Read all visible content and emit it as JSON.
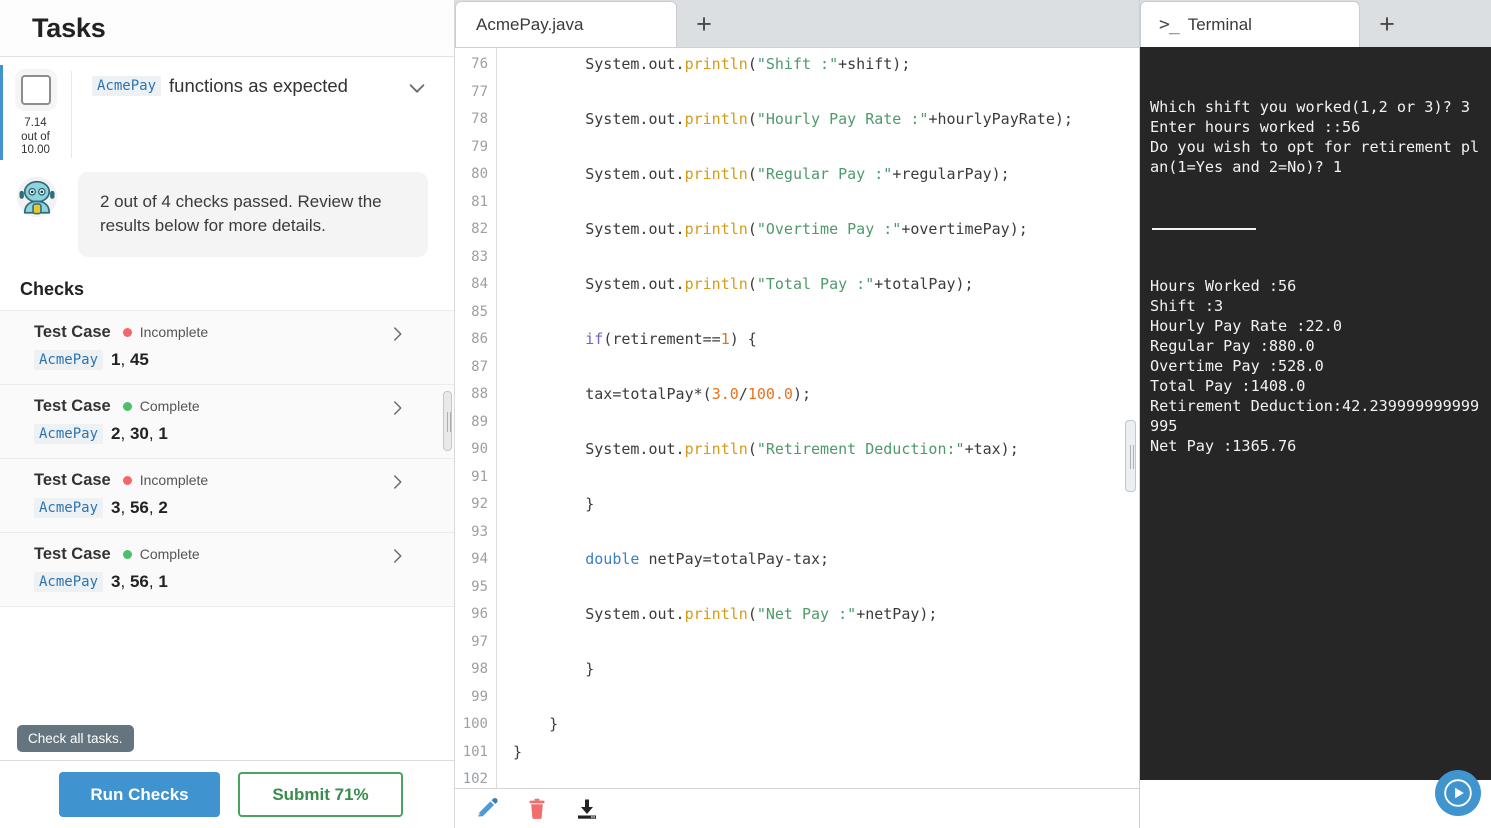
{
  "sidebar": {
    "header_title": "Tasks",
    "task": {
      "chip": "AcmePay",
      "title": "functions as expected",
      "score_line1": "7.14",
      "score_line2": "out of",
      "score_line3": "10.00"
    },
    "bot_message": "2 out of 4 checks passed. Review the results below for more details.",
    "checks_heading": "Checks",
    "checks": [
      {
        "name": "Test Case",
        "status": "Incomplete",
        "status_color": "#f2686a",
        "chip": "AcmePay",
        "args": "1, 45"
      },
      {
        "name": "Test Case",
        "status": "Complete",
        "status_color": "#4cbf6a",
        "chip": "AcmePay",
        "args": "2, 30, 1"
      },
      {
        "name": "Test Case",
        "status": "Incomplete",
        "status_color": "#f2686a",
        "chip": "AcmePay",
        "args": "3, 56, 2"
      },
      {
        "name": "Test Case",
        "status": "Complete",
        "status_color": "#4cbf6a",
        "chip": "AcmePay",
        "args": "3, 56, 1"
      }
    ],
    "tooltip": "Check all tasks.",
    "run_checks_label": "Run Checks",
    "submit_label": "Submit 71%",
    "accent_color": "#3f93cf",
    "submit_color": "#4aa35e"
  },
  "editor": {
    "tab_label": "AcmePay.java",
    "add_tab_label": "+",
    "first_line_number": 76,
    "lines": [
      {
        "n": 76,
        "indent": 4,
        "tokens": [
          {
            "t": "System.out.",
            "c": "plain"
          },
          {
            "t": "println",
            "c": "fn"
          },
          {
            "t": "(",
            "c": "plain"
          },
          {
            "t": "\"Shift :\"",
            "c": "str"
          },
          {
            "t": "+shift);",
            "c": "plain"
          }
        ]
      },
      {
        "n": 77,
        "indent": 0,
        "tokens": []
      },
      {
        "n": 78,
        "indent": 4,
        "tokens": [
          {
            "t": "System.out.",
            "c": "plain"
          },
          {
            "t": "println",
            "c": "fn"
          },
          {
            "t": "(",
            "c": "plain"
          },
          {
            "t": "\"Hourly Pay Rate :\"",
            "c": "str"
          },
          {
            "t": "+hourlyPayRate);",
            "c": "plain"
          }
        ]
      },
      {
        "n": 79,
        "indent": 0,
        "tokens": []
      },
      {
        "n": 80,
        "indent": 4,
        "tokens": [
          {
            "t": "System.out.",
            "c": "plain"
          },
          {
            "t": "println",
            "c": "fn"
          },
          {
            "t": "(",
            "c": "plain"
          },
          {
            "t": "\"Regular Pay :\"",
            "c": "str"
          },
          {
            "t": "+regularPay);",
            "c": "plain"
          }
        ]
      },
      {
        "n": 81,
        "indent": 0,
        "tokens": []
      },
      {
        "n": 82,
        "indent": 4,
        "tokens": [
          {
            "t": "System.out.",
            "c": "plain"
          },
          {
            "t": "println",
            "c": "fn"
          },
          {
            "t": "(",
            "c": "plain"
          },
          {
            "t": "\"Overtime Pay :\"",
            "c": "str"
          },
          {
            "t": "+overtimePay);",
            "c": "plain"
          }
        ]
      },
      {
        "n": 83,
        "indent": 0,
        "tokens": []
      },
      {
        "n": 84,
        "indent": 4,
        "tokens": [
          {
            "t": "System.out.",
            "c": "plain"
          },
          {
            "t": "println",
            "c": "fn"
          },
          {
            "t": "(",
            "c": "plain"
          },
          {
            "t": "\"Total Pay :\"",
            "c": "str"
          },
          {
            "t": "+totalPay);",
            "c": "plain"
          }
        ]
      },
      {
        "n": 85,
        "indent": 0,
        "tokens": []
      },
      {
        "n": 86,
        "indent": 4,
        "tokens": [
          {
            "t": "if",
            "c": "kw"
          },
          {
            "t": "(retirement==",
            "c": "plain"
          },
          {
            "t": "1",
            "c": "num"
          },
          {
            "t": ") {",
            "c": "plain"
          }
        ]
      },
      {
        "n": 87,
        "indent": 0,
        "tokens": []
      },
      {
        "n": 88,
        "indent": 4,
        "tokens": [
          {
            "t": "tax=totalPay*(",
            "c": "plain"
          },
          {
            "t": "3.0",
            "c": "num"
          },
          {
            "t": "/",
            "c": "plain"
          },
          {
            "t": "100.0",
            "c": "num"
          },
          {
            "t": ");",
            "c": "plain"
          }
        ]
      },
      {
        "n": 89,
        "indent": 0,
        "tokens": []
      },
      {
        "n": 90,
        "indent": 4,
        "tokens": [
          {
            "t": "System.out.",
            "c": "plain"
          },
          {
            "t": "println",
            "c": "fn"
          },
          {
            "t": "(",
            "c": "plain"
          },
          {
            "t": "\"Retirement Deduction:\"",
            "c": "str"
          },
          {
            "t": "+tax);",
            "c": "plain"
          }
        ]
      },
      {
        "n": 91,
        "indent": 0,
        "tokens": []
      },
      {
        "n": 92,
        "indent": 4,
        "tokens": [
          {
            "t": "}",
            "c": "plain"
          }
        ]
      },
      {
        "n": 93,
        "indent": 0,
        "tokens": []
      },
      {
        "n": 94,
        "indent": 4,
        "tokens": [
          {
            "t": "double",
            "c": "type"
          },
          {
            "t": " netPay=totalPay-tax;",
            "c": "plain"
          }
        ]
      },
      {
        "n": 95,
        "indent": 0,
        "tokens": []
      },
      {
        "n": 96,
        "indent": 4,
        "tokens": [
          {
            "t": "System.out.",
            "c": "plain"
          },
          {
            "t": "println",
            "c": "fn"
          },
          {
            "t": "(",
            "c": "plain"
          },
          {
            "t": "\"Net Pay :\"",
            "c": "str"
          },
          {
            "t": "+netPay);",
            "c": "plain"
          }
        ]
      },
      {
        "n": 97,
        "indent": 0,
        "tokens": []
      },
      {
        "n": 98,
        "indent": 4,
        "tokens": [
          {
            "t": "}",
            "c": "plain"
          }
        ]
      },
      {
        "n": 99,
        "indent": 0,
        "tokens": []
      },
      {
        "n": 100,
        "indent": 2,
        "tokens": [
          {
            "t": "}",
            "c": "plain"
          }
        ]
      },
      {
        "n": 101,
        "indent": 0,
        "tokens": [
          {
            "t": "}",
            "c": "plain"
          }
        ]
      },
      {
        "n": 102,
        "indent": 0,
        "tokens": []
      }
    ],
    "footer_icons": [
      "pencil-icon",
      "trash-icon",
      "download-icon"
    ]
  },
  "terminal": {
    "tab_label": "Terminal",
    "prompt_glyph": ">_",
    "add_tab_label": "+",
    "output_top": "Which shift you worked(1,2 or 3)? 3\nEnter hours worked ::56\nDo you wish to opt for retirement plan(1=Yes and 2=No)? 1",
    "output_bottom": "Hours Worked :56\nShift :3\nHourly Pay Rate :22.0\nRegular Pay :880.0\nOvertime Pay :528.0\nTotal Pay :1408.0\nRetirement Deduction:42.239999999999995\nNet Pay :1365.76",
    "background": "#262626",
    "text_color": "#f2f2f2"
  },
  "run_button": {
    "name": "run-program",
    "color": "#4195cf"
  }
}
